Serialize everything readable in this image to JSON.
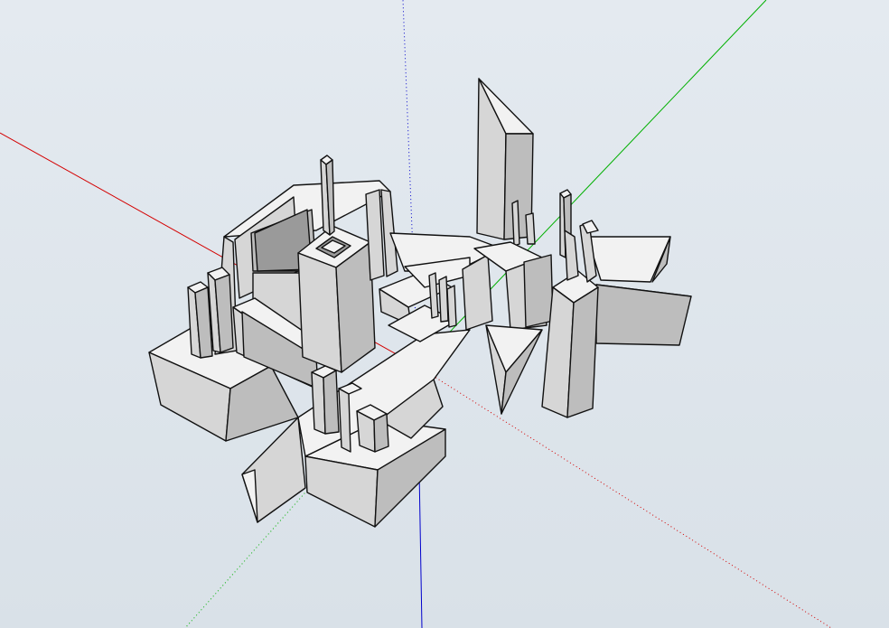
{
  "viewport": {
    "background": "#dfe6ec",
    "axes": {
      "x_color": "#d40000",
      "y_color": "#00b000",
      "z_color": "#0000cc"
    },
    "model_colors": {
      "top": "#f2f2f2",
      "left": "#d6d6d6",
      "right": "#bdbdbd",
      "edge": "#111111"
    }
  }
}
